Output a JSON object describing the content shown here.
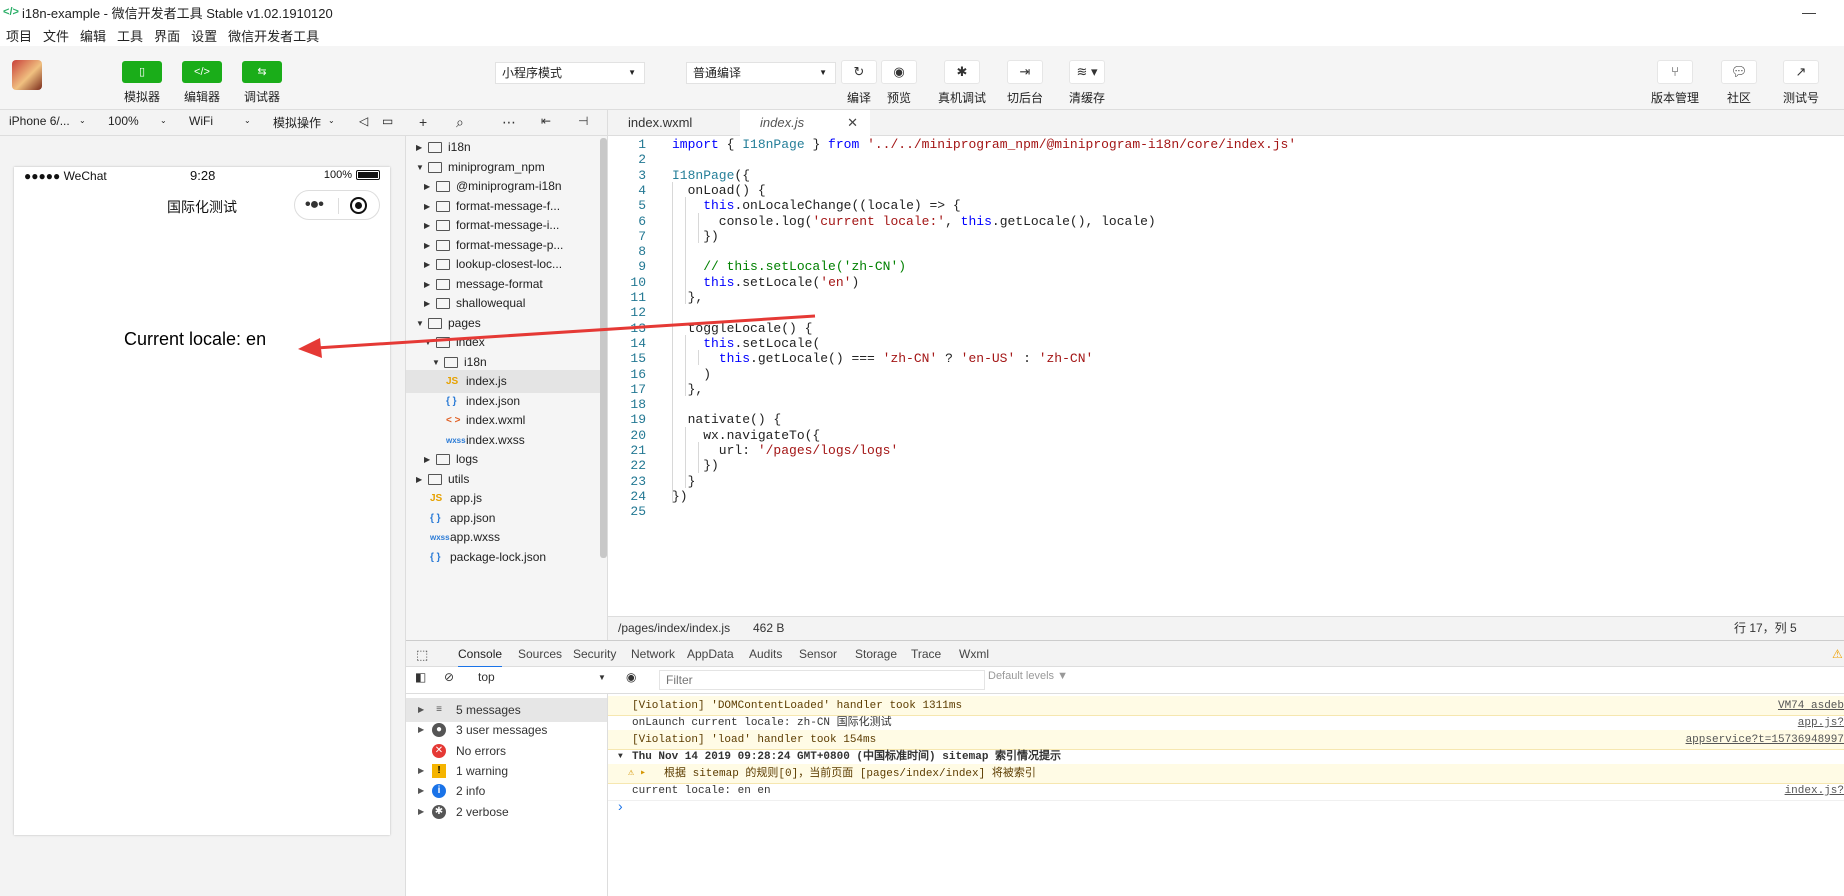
{
  "window": {
    "title": "i18n-example - 微信开发者工具 Stable v1.02.1910120",
    "minimize": "—"
  },
  "menu": [
    "项目",
    "文件",
    "编辑",
    "工具",
    "界面",
    "设置",
    "微信开发者工具"
  ],
  "toolbar": {
    "simulator_label": "模拟器",
    "editor_label": "编辑器",
    "debugger_label": "调试器",
    "mode_select": "小程序模式",
    "compile_select": "普通编译",
    "compile_label": "编译",
    "preview_label": "预览",
    "remote_debug_label": "真机调试",
    "background_label": "切后台",
    "clear_cache_label": "清缓存",
    "version_label": "版本管理",
    "community_label": "社区",
    "test_label": "测试号"
  },
  "simulator_bar": {
    "device": "iPhone 6/...",
    "zoom": "100%",
    "network": "WiFi",
    "operation": "模拟操作"
  },
  "phone": {
    "carrier": "●●●●● WeChat",
    "time": "9:28",
    "battery": "100%",
    "nav_title": "国际化测试",
    "content_text": "Current locale: en"
  },
  "file_tree": [
    {
      "name": "i18n",
      "type": "folder",
      "depth": 0,
      "open": false
    },
    {
      "name": "miniprogram_npm",
      "type": "folder",
      "depth": 0,
      "open": true
    },
    {
      "name": "@miniprogram-i18n",
      "type": "folder",
      "depth": 1,
      "open": false
    },
    {
      "name": "format-message-f...",
      "type": "folder",
      "depth": 1,
      "open": false
    },
    {
      "name": "format-message-i...",
      "type": "folder",
      "depth": 1,
      "open": false
    },
    {
      "name": "format-message-p...",
      "type": "folder",
      "depth": 1,
      "open": false
    },
    {
      "name": "lookup-closest-loc...",
      "type": "folder",
      "depth": 1,
      "open": false
    },
    {
      "name": "message-format",
      "type": "folder",
      "depth": 1,
      "open": false
    },
    {
      "name": "shallowequal",
      "type": "folder",
      "depth": 1,
      "open": false
    },
    {
      "name": "pages",
      "type": "folder",
      "depth": 0,
      "open": true
    },
    {
      "name": "index",
      "type": "folder",
      "depth": 1,
      "open": true
    },
    {
      "name": "i18n",
      "type": "folder",
      "depth": 2,
      "open": true
    },
    {
      "name": "index.js",
      "type": "js",
      "depth": 2,
      "selected": true
    },
    {
      "name": "index.json",
      "type": "json",
      "depth": 2
    },
    {
      "name": "index.wxml",
      "type": "wxml",
      "depth": 2
    },
    {
      "name": "index.wxss",
      "type": "wxss",
      "depth": 2
    },
    {
      "name": "logs",
      "type": "folder",
      "depth": 1,
      "open": false
    },
    {
      "name": "utils",
      "type": "folder",
      "depth": 0,
      "open": false
    },
    {
      "name": "app.js",
      "type": "js",
      "depth": 0
    },
    {
      "name": "app.json",
      "type": "json",
      "depth": 0
    },
    {
      "name": "app.wxss",
      "type": "wxss",
      "depth": 0
    },
    {
      "name": "package-lock.json",
      "type": "json",
      "depth": 0
    }
  ],
  "file_icons": {
    "js": "JS",
    "json": "{ }",
    "wxml": "< >",
    "wxss": "wxss"
  },
  "editor_tabs": [
    {
      "label": "index.wxml",
      "active": false
    },
    {
      "label": "index.js",
      "active": true,
      "close": "✕"
    }
  ],
  "code_lines": [
    "import { I18nPage } from '../../miniprogram_npm/@miniprogram-i18n/core/index.js'",
    "",
    "I18nPage({",
    "  onLoad() {",
    "    this.onLocaleChange((locale) => {",
    "      console.log('current locale:', this.getLocale(), locale)",
    "    })",
    "",
    "    // this.setLocale('zh-CN')",
    "    this.setLocale('en')",
    "  },",
    "",
    "  toggleLocale() {",
    "    this.setLocale(",
    "      this.getLocale() === 'zh-CN' ? 'en-US' : 'zh-CN'",
    "    )",
    "  },",
    "",
    "  nativate() {",
    "    wx.navigateTo({",
    "      url: '/pages/logs/logs'",
    "    })",
    "  }",
    "})",
    ""
  ],
  "editor_status": {
    "path": "/pages/index/index.js",
    "size": "462 B",
    "position": "行 17，列 5"
  },
  "devtools_tabs": [
    "Console",
    "Sources",
    "Security",
    "Network",
    "AppData",
    "Audits",
    "Sensor",
    "Storage",
    "Trace",
    "Wxml"
  ],
  "console_toolbar": {
    "context": "top",
    "filter_placeholder": "Filter",
    "levels": "Default levels ▼"
  },
  "console_sidebar": [
    {
      "label": "5 messages",
      "icon": "list",
      "selected": true
    },
    {
      "label": "3 user messages",
      "icon": "user"
    },
    {
      "label": "No errors",
      "icon": "error"
    },
    {
      "label": "1 warning",
      "icon": "warning"
    },
    {
      "label": "2 info",
      "icon": "info"
    },
    {
      "label": "2 verbose",
      "icon": "verbose"
    }
  ],
  "console_logs": [
    {
      "text": "[Violation] 'DOMContentLoaded' handler took 1311ms",
      "source": "VM74 asdeb",
      "level": "warn"
    },
    {
      "text": "onLaunch current locale: zh-CN 国际化测试",
      "source": "app.js?",
      "level": "log"
    },
    {
      "text": "[Violation] 'load' handler took 154ms",
      "source": "appservice?t=15736948997",
      "level": "warn"
    },
    {
      "text": "Thu Nov 14 2019 09:28:24 GMT+0800 (中国标准时间) sitemap 索引情况提示",
      "source": "",
      "level": "group"
    },
    {
      "text": "根据 sitemap 的规则[0]，当前页面 [pages/index/index] 将被索引",
      "source": "",
      "level": "warnsub"
    },
    {
      "text": "current locale: en en",
      "source": "index.js?",
      "level": "log"
    }
  ],
  "console_prompt": "›",
  "colors": {
    "accent": "#1aad19",
    "arrow": "#e53935"
  }
}
